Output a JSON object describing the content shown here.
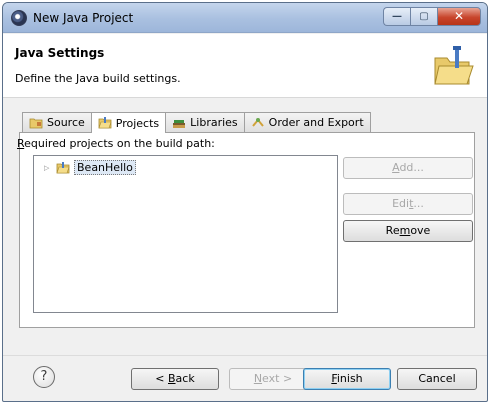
{
  "window": {
    "title": "New Java Project",
    "controls": {
      "minimize": "—",
      "maximize": "▢",
      "close": "✕"
    }
  },
  "header": {
    "title": "Java Settings",
    "description": "Define the Java build settings."
  },
  "tabs": [
    {
      "label": "Source",
      "icon": "source-folder-icon"
    },
    {
      "label": "Projects",
      "icon": "project-folder-icon",
      "active": true
    },
    {
      "label": "Libraries",
      "icon": "libraries-icon"
    },
    {
      "label": "Order and Export",
      "icon": "order-export-icon"
    }
  ],
  "projects": {
    "label_prefix": "R",
    "label_rest": "equired projects on the build path:",
    "items": [
      {
        "label": "BeanHello",
        "icon": "project-folder-icon"
      }
    ]
  },
  "side_buttons": {
    "add": {
      "pre": "",
      "u": "A",
      "post": "dd...",
      "enabled": false
    },
    "edit": {
      "pre": "Edi",
      "u": "t",
      "post": "...",
      "enabled": false
    },
    "remove": {
      "pre": "Re",
      "u": "m",
      "post": "ove",
      "enabled": true
    }
  },
  "footer": {
    "help": "?",
    "back": {
      "pre": "< ",
      "u": "B",
      "post": "ack",
      "enabled": true
    },
    "next": {
      "pre": "",
      "u": "N",
      "post": "ext >",
      "enabled": false
    },
    "finish": {
      "pre": "",
      "u": "F",
      "post": "inish",
      "enabled": true
    },
    "cancel": {
      "label": "Cancel",
      "enabled": true
    }
  }
}
